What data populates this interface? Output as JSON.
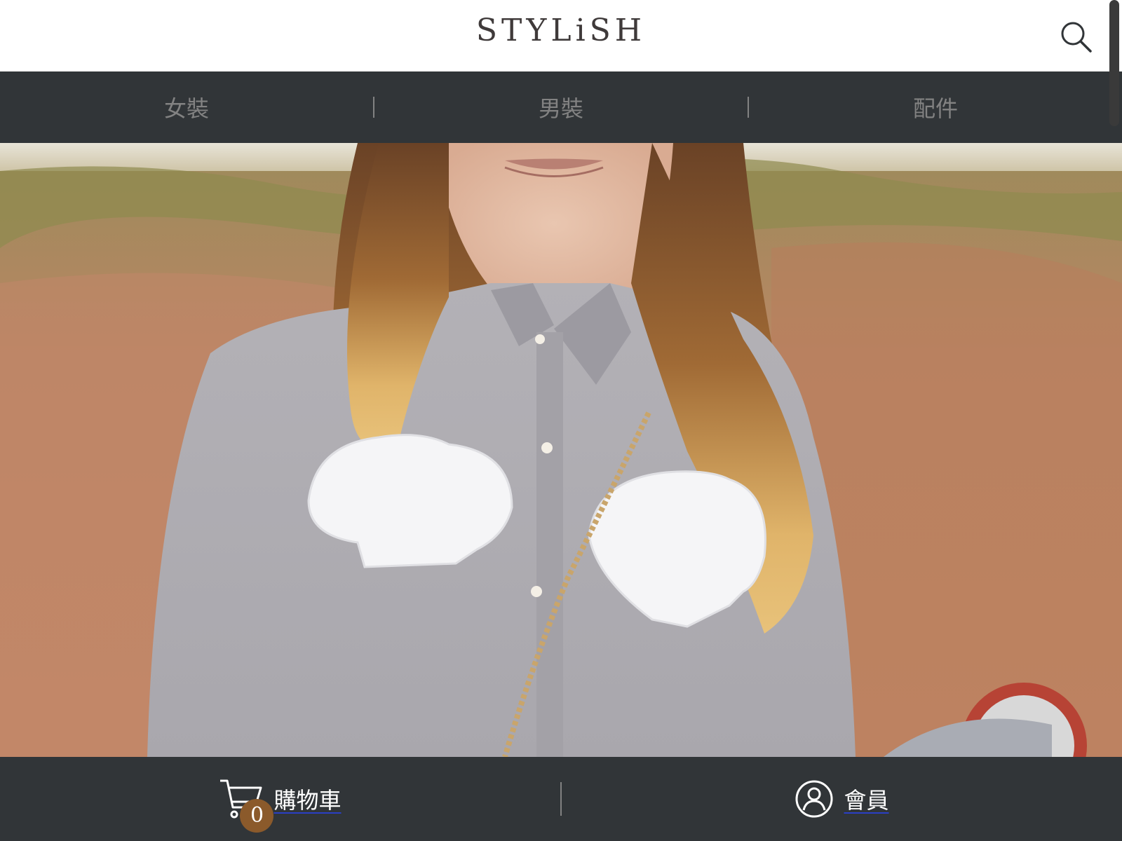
{
  "header": {
    "logo_text": "STYLiSH",
    "search_icon": "search-icon"
  },
  "nav": {
    "items": [
      {
        "label": "女裝"
      },
      {
        "label": "男裝"
      },
      {
        "label": "配件"
      }
    ]
  },
  "hero": {
    "image": "woman in grey sheer blouse with white shell patches and gold chain bag strap"
  },
  "bottom_bar": {
    "cart": {
      "label": "購物車",
      "icon": "cart-icon",
      "count": "0"
    },
    "member": {
      "label": "會員",
      "icon": "member-icon"
    }
  },
  "colors": {
    "nav_bg": "#313538",
    "nav_text": "#828282",
    "logo": "#3f3a3a",
    "badge": "#8b5a2b"
  }
}
